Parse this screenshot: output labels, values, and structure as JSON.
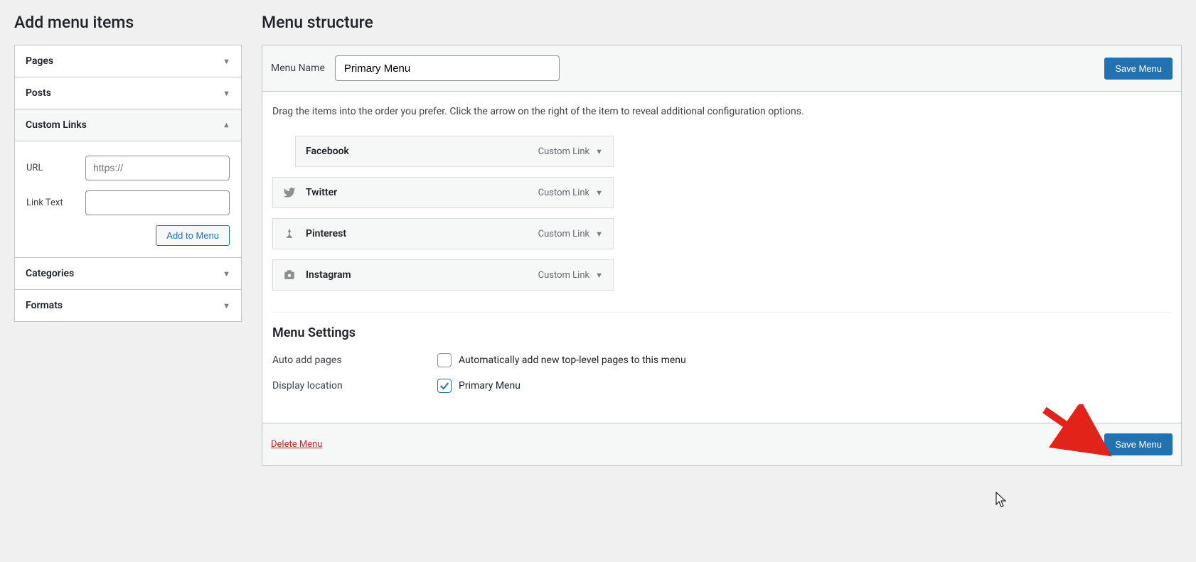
{
  "left": {
    "heading": "Add menu items",
    "accordion": [
      {
        "label": "Pages",
        "expanded": false
      },
      {
        "label": "Posts",
        "expanded": false
      },
      {
        "label": "Custom Links",
        "expanded": true,
        "url_label": "URL",
        "url_placeholder": "https://",
        "link_text_label": "Link Text",
        "add_button": "Add to Menu"
      },
      {
        "label": "Categories",
        "expanded": false
      },
      {
        "label": "Formats",
        "expanded": false
      }
    ]
  },
  "right": {
    "heading": "Menu structure",
    "menu_name_label": "Menu Name",
    "menu_name_value": "Primary Menu",
    "save_label": "Save Menu",
    "instructions": "Drag the items into the order you prefer. Click the arrow on the right of the item to reveal additional configuration options.",
    "items": [
      {
        "title": "Facebook",
        "type": "Custom Link",
        "icon": "",
        "indent": true
      },
      {
        "title": "Twitter",
        "type": "Custom Link",
        "icon": "twitter",
        "indent": false
      },
      {
        "title": "Pinterest",
        "type": "Custom Link",
        "icon": "pin",
        "indent": false
      },
      {
        "title": "Instagram",
        "type": "Custom Link",
        "icon": "camera",
        "indent": false
      }
    ],
    "settings_heading": "Menu Settings",
    "auto_add_label": "Auto add pages",
    "auto_add_option": "Automatically add new top-level pages to this menu",
    "auto_add_checked": false,
    "display_loc_label": "Display location",
    "display_loc_option": "Primary Menu",
    "display_loc_checked": true,
    "delete_label": "Delete Menu"
  }
}
